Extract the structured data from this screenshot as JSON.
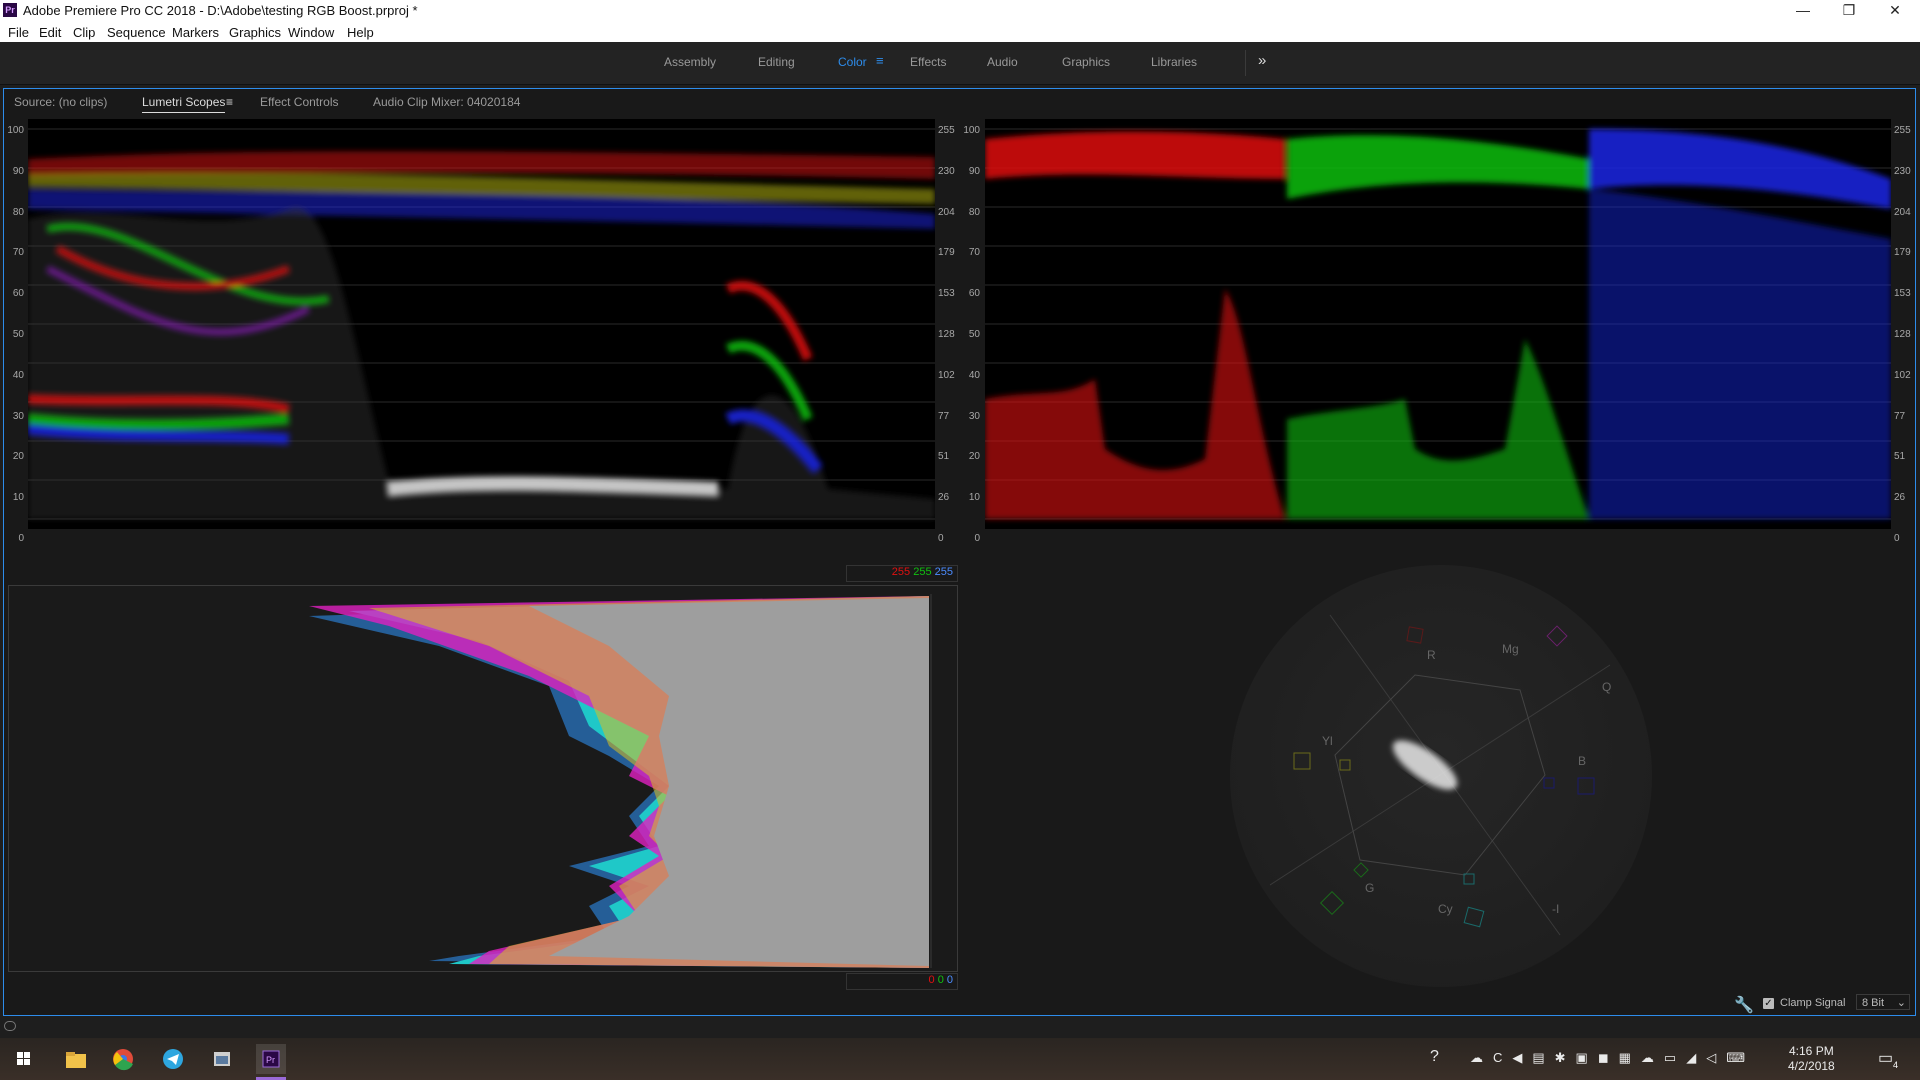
{
  "window": {
    "title": "Adobe Premiere Pro CC 2018 - D:\\Adobe\\testing RGB Boost.prproj *",
    "app_icon": "Pr",
    "minimize": "—",
    "restore": "❐",
    "close": "✕"
  },
  "menu": [
    "File",
    "Edit",
    "Clip",
    "Sequence",
    "Markers",
    "Graphics",
    "Window",
    "Help"
  ],
  "workspaces": {
    "items": [
      "Assembly",
      "Editing",
      "Color",
      "Effects",
      "Audio",
      "Graphics",
      "Libraries"
    ],
    "active": "Color",
    "overflow": "»"
  },
  "panel_tabs": {
    "source": "Source: (no clips)",
    "lumetri": "Lumetri Scopes",
    "effect_controls": "Effect Controls",
    "audio_mixer": "Audio Clip Mixer: 04020184"
  },
  "scope_axes": {
    "left_ire": [
      "100",
      "90",
      "80",
      "70",
      "60",
      "50",
      "40",
      "30",
      "20",
      "10",
      "0"
    ],
    "right_8bit": [
      "255",
      "230",
      "204",
      "179",
      "153",
      "128",
      "102",
      "77",
      "51",
      "26",
      "0"
    ]
  },
  "histogram": {
    "top_values": [
      "255",
      "255",
      "255"
    ],
    "bottom_values": [
      "0",
      "0",
      "0"
    ]
  },
  "vectorscope": {
    "labels": [
      "R",
      "Mg",
      "Q",
      "B",
      "Cy",
      "-I",
      "G",
      "Yl"
    ]
  },
  "bottom_controls": {
    "clamp_signal": "Clamp Signal",
    "clamp_checked": true,
    "bit_depth": "8 Bit"
  },
  "taskbar": {
    "time": "4:16 PM",
    "date": "4/2/2018",
    "notifications": "4"
  },
  "colors": {
    "accent": "#2d8ceb",
    "red": "#e01010",
    "green": "#10c010",
    "blue": "#1a28e6"
  }
}
